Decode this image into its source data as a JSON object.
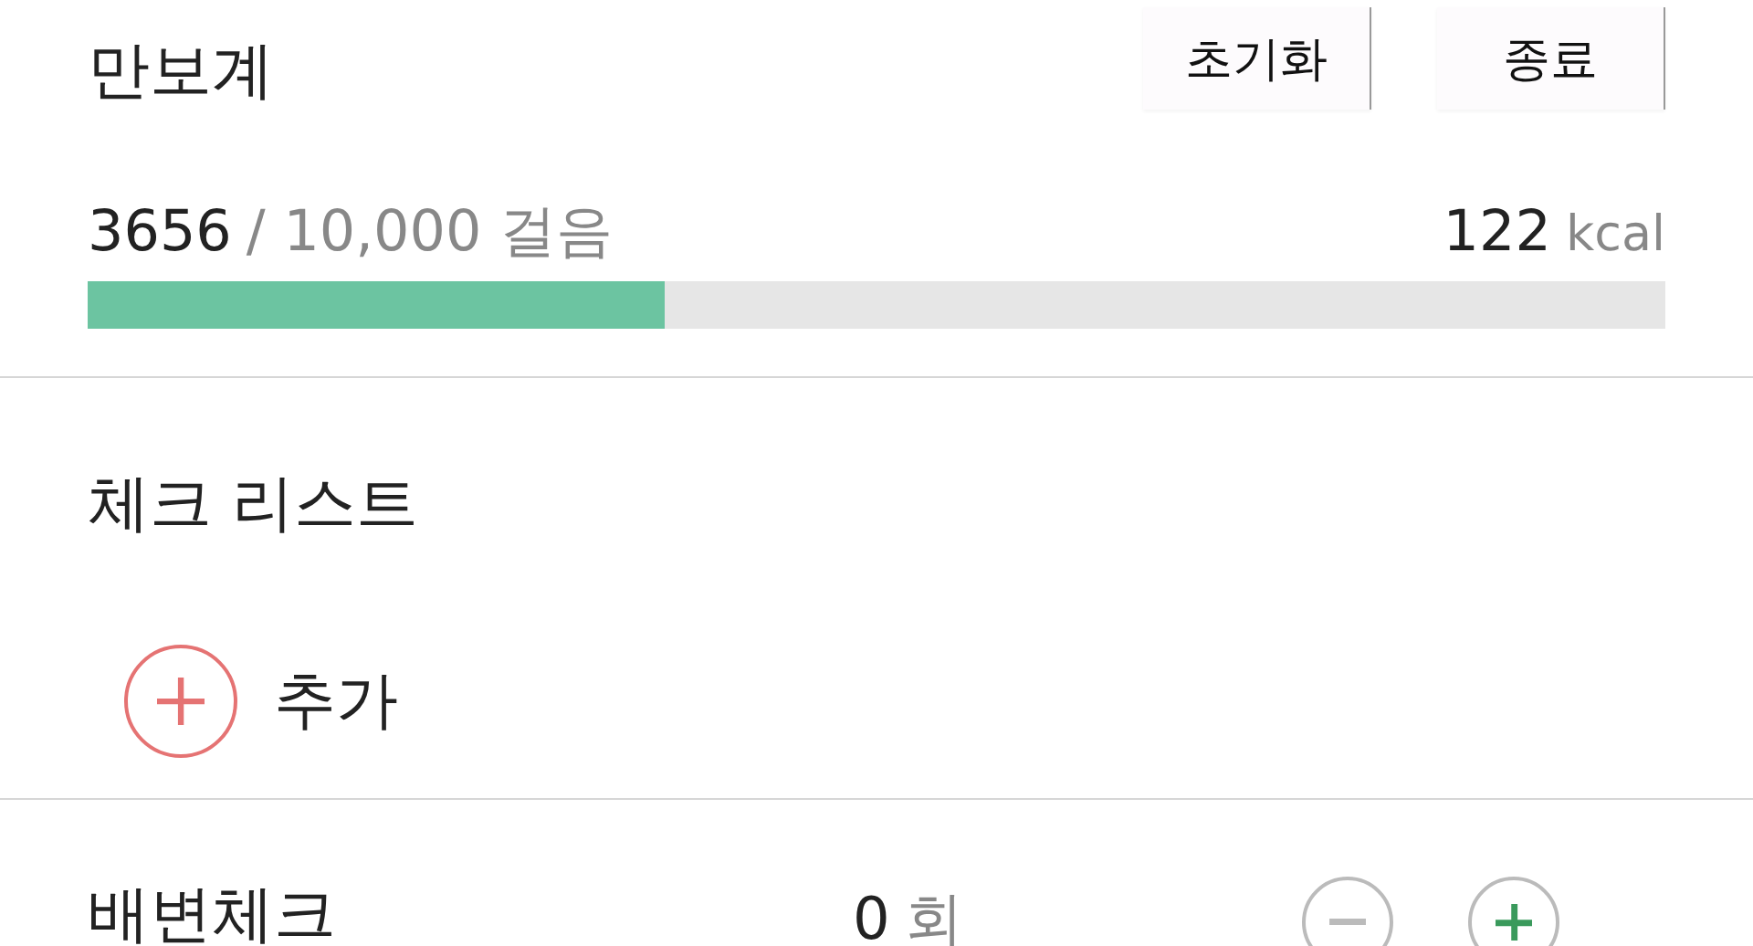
{
  "header": {
    "title": "만보계",
    "buttons": [
      {
        "label": "초기화"
      },
      {
        "label": "종료"
      }
    ]
  },
  "pedometer": {
    "steps": "3656",
    "goal": "/ 10,000 걸음",
    "level": 0.3656,
    "calories": "122",
    "calorie_unit": "kcal"
  },
  "checklist": {
    "title": "체크 리스트",
    "add_label": "추가"
  },
  "counter": {
    "label": "배변체크",
    "count": "0",
    "unit": "회"
  }
}
